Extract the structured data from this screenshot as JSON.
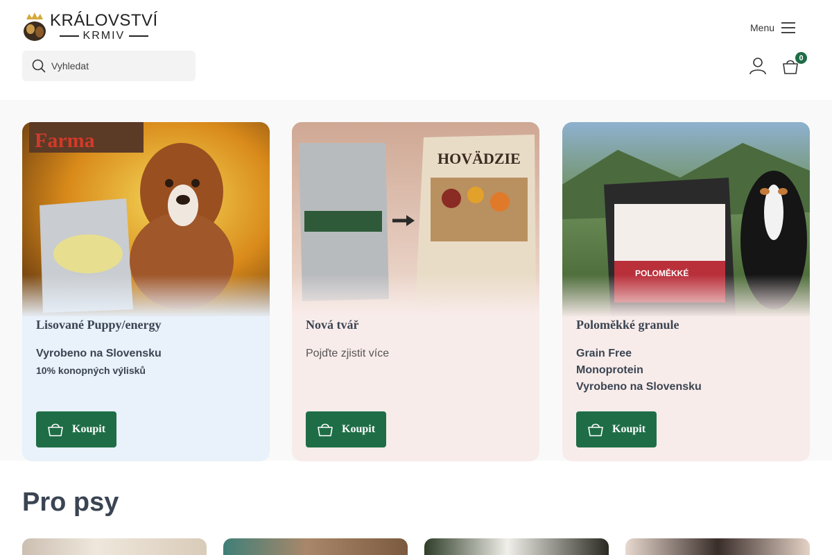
{
  "header": {
    "logo_line1": "KRÁLOVSTVÍ",
    "logo_line2": "KRMIV",
    "menu_label": "Menu",
    "search_placeholder": "Vyhledat",
    "cart_count": "0"
  },
  "colors": {
    "accent_green": "#1e6d46",
    "card1_bg": "#e9f1fa",
    "card2_bg": "#f8ecea",
    "heading": "#3a4452"
  },
  "cards": [
    {
      "title": "Lisované Puppy/energy",
      "line1": "Vyrobeno na Slovensku",
      "line2": "10% konopných výlisků",
      "button": "Koupit",
      "image_text": "Farma"
    },
    {
      "title": "Nová tvář",
      "line1": "Pojďte zjistit více",
      "button": "Koupit",
      "image_text": "HOVÄDZIE"
    },
    {
      "title": "Poloměkké granule",
      "line1": "Grain Free",
      "line2": "Monoprotein",
      "line3": "Vyrobeno na Slovensku",
      "button": "Koupit",
      "image_text": "POLOMĚKKÉ"
    }
  ],
  "section": {
    "title": "Pro psy"
  },
  "icons": [
    "search-icon",
    "hamburger-icon",
    "user-icon",
    "cart-icon",
    "basket-icon"
  ]
}
